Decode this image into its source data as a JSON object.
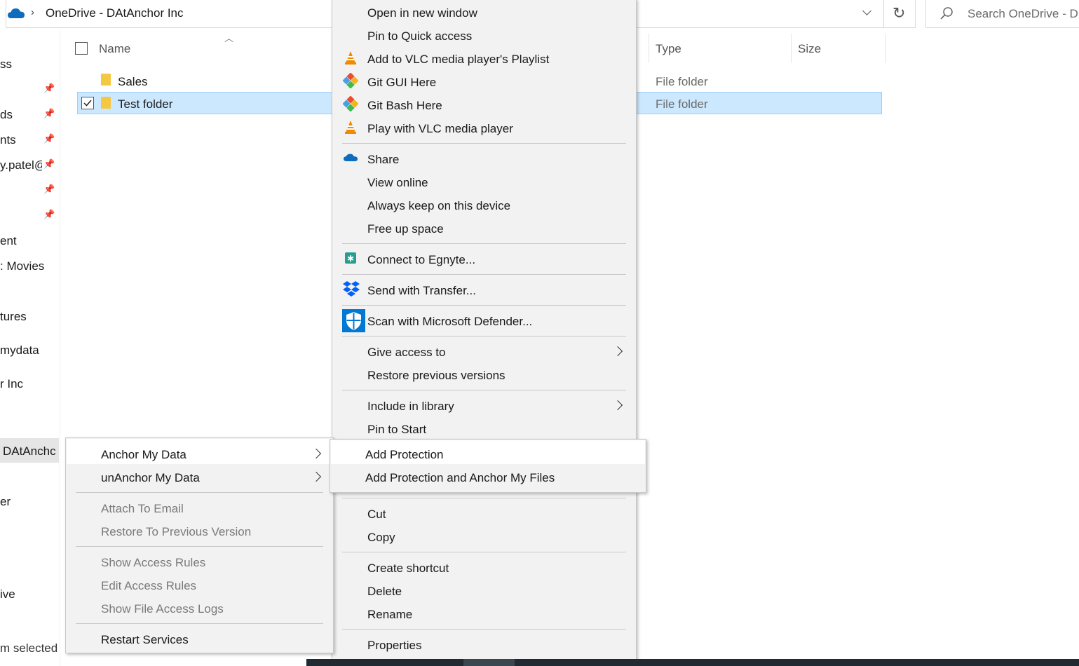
{
  "address": {
    "path": "OneDrive - DAtAnchor Inc",
    "search_placeholder": "Search OneDrive - D"
  },
  "nav": {
    "items": [
      "ss",
      "ds",
      "nts",
      "y.patel@",
      "ent",
      ": Movies",
      "tures",
      "mydata",
      "r Inc",
      "DAtAnchc",
      "er",
      "ive"
    ],
    "status": "m selected"
  },
  "columns": {
    "name": "Name",
    "type": "Type",
    "size": "Size"
  },
  "files": [
    {
      "name": "Sales",
      "type": "File folder",
      "selected": false
    },
    {
      "name": "Test folder",
      "type": "File folder",
      "selected": true
    }
  ],
  "main_menu": {
    "group1": [
      "Open in new window",
      "Pin to Quick access",
      "Add to VLC media player's Playlist",
      "Git GUI Here",
      "Git Bash Here",
      "Play with VLC media player"
    ],
    "group2": [
      "Share",
      "View online",
      "Always keep on this device",
      "Free up space"
    ],
    "egnyte": "Connect to Egnyte...",
    "dropbox": "Send with Transfer...",
    "defender": "Scan with Microsoft Defender...",
    "group3": [
      "Give access to",
      "Restore previous versions"
    ],
    "group4": [
      "Include in library",
      "Pin to Start"
    ],
    "group5": [
      "Cut",
      "Copy"
    ],
    "group6": [
      "Create shortcut",
      "Delete",
      "Rename"
    ],
    "properties": "Properties"
  },
  "anchor_menu": {
    "items": [
      "Anchor My Data",
      "unAnchor My Data"
    ],
    "group2": [
      "Attach To Email",
      "Restore To Previous Version"
    ],
    "group3": [
      "Show Access Rules",
      "Edit Access Rules",
      "Show File Access Logs"
    ],
    "restart": "Restart Services"
  },
  "protect_menu": {
    "items": [
      "Add Protection",
      "Add Protection and Anchor My Files"
    ]
  },
  "colors": {
    "selection": "#cce8ff",
    "menu_bg": "#f2f2f2",
    "onedrive_blue": "#0f6cbd",
    "vlc_orange": "#f08a00"
  }
}
